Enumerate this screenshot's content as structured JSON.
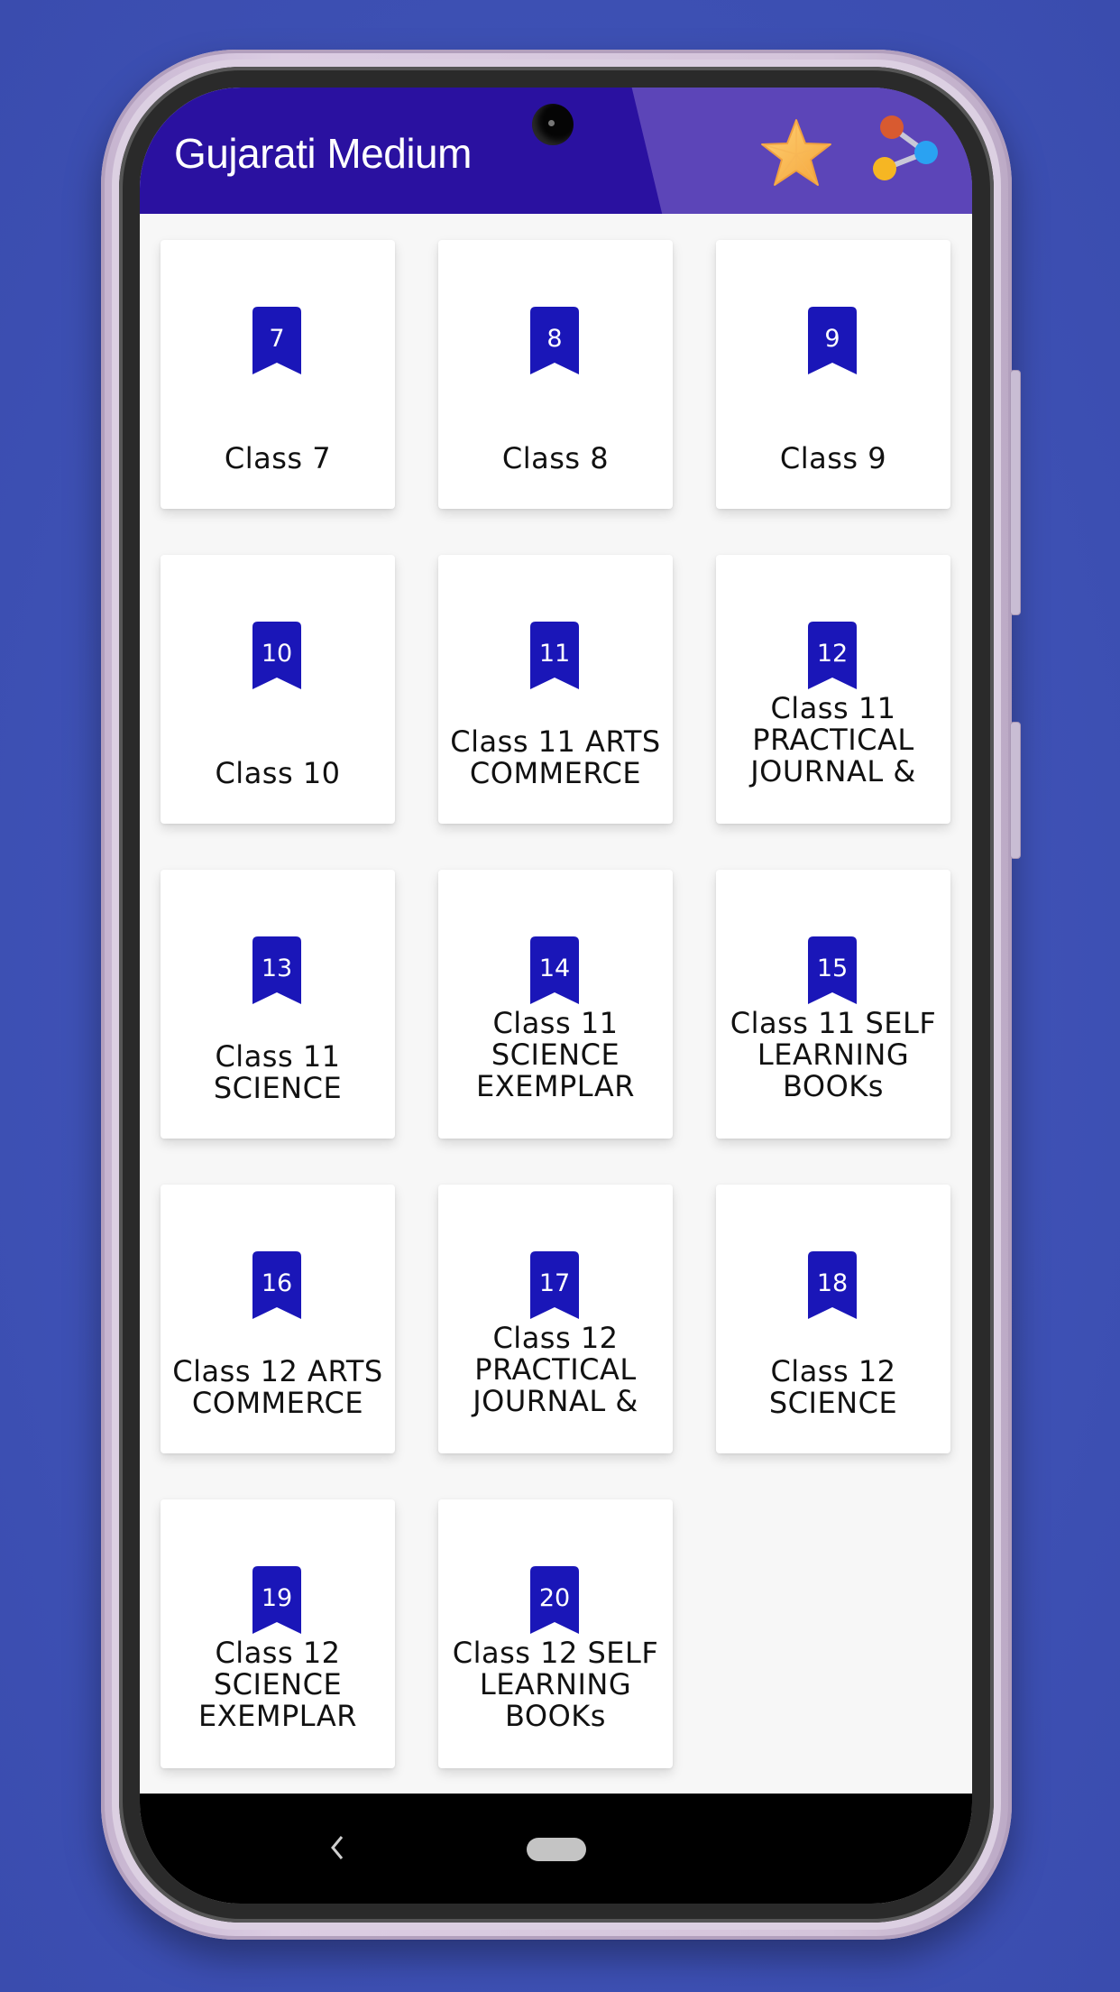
{
  "app_bar": {
    "title": "Gujarati Medium",
    "actions": [
      {
        "name": "rate-star",
        "icon": "star-icon"
      },
      {
        "name": "share",
        "icon": "share-icon"
      }
    ]
  },
  "colors": {
    "app_bar": "#2a11a0",
    "badge": "#1a16b8",
    "background": "#3e51b5"
  },
  "cards": [
    {
      "badge": "7",
      "label": "Class 7"
    },
    {
      "badge": "8",
      "label": "Class 8"
    },
    {
      "badge": "9",
      "label": "Class 9"
    },
    {
      "badge": "10",
      "label": "Class 10"
    },
    {
      "badge": "11",
      "label": "Class 11 ARTS COMMERCE"
    },
    {
      "badge": "12",
      "label": "Class 11 PRACTICAL JOURNAL &"
    },
    {
      "badge": "13",
      "label": "Class 11 SCIENCE"
    },
    {
      "badge": "14",
      "label": "Class 11 SCIENCE EXEMPLAR"
    },
    {
      "badge": "15",
      "label": "Class 11 SELF LEARNING BOOKs"
    },
    {
      "badge": "16",
      "label": "Class 12 ARTS COMMERCE"
    },
    {
      "badge": "17",
      "label": "Class 12 PRACTICAL JOURNAL &"
    },
    {
      "badge": "18",
      "label": "Class 12 SCIENCE"
    },
    {
      "badge": "19",
      "label": "Class 12 SCIENCE EXEMPLAR"
    },
    {
      "badge": "20",
      "label": "Class 12 SELF LEARNING BOOKs"
    }
  ],
  "nav_bar": {
    "back": "back-icon",
    "home": "home-pill"
  }
}
